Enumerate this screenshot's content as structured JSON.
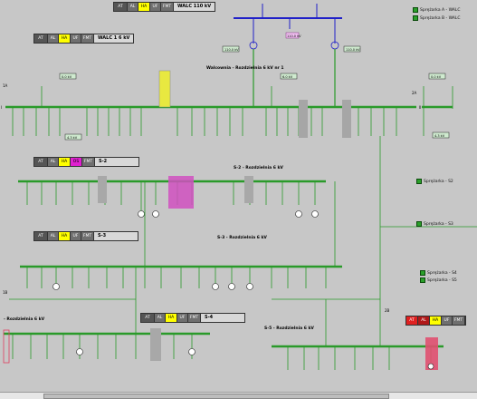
{
  "status_bars": [
    {
      "id": "walc110",
      "buttons": [
        "AT",
        "AL",
        "HA",
        "UF",
        "FMT"
      ],
      "label": "WALC 110 kV"
    },
    {
      "id": "walc16",
      "buttons": [
        "AT",
        "AL",
        "HA",
        "UF",
        "FMT"
      ],
      "label": "WALC 1 6 kV"
    },
    {
      "id": "s2",
      "buttons": [
        "AT",
        "AL",
        "HA",
        "OS",
        "FMT"
      ],
      "label": "S-2"
    },
    {
      "id": "s3",
      "buttons": [
        "AT",
        "AL",
        "HA",
        "UF",
        "FMT"
      ],
      "label": "S-3"
    },
    {
      "id": "s4",
      "buttons": [
        "AT",
        "AL",
        "HA",
        "UF",
        "FMT"
      ],
      "label": "S-4"
    },
    {
      "id": "s5",
      "buttons": [
        "AT",
        "AL",
        "HA",
        "UF",
        "FMT"
      ]
    }
  ],
  "legend": {
    "top": [
      "Sprężarka A - WALC",
      "Sprężarka B - WALC"
    ],
    "s2": "Sprężarka - S2",
    "s3": "Sprężarka - S3",
    "s4": [
      "Sprężarka - S4",
      "Sprężarka - S5"
    ]
  },
  "titles": {
    "walcownia": "Walcownia - Rozdzielnia 6 kV nr 1",
    "s2": "S-2 - Rozdzielnia 6 kV",
    "s3": "S-3 - Rozdzielnia 6 kV",
    "s4": "- Rozdzielnia 6 kV",
    "s5": "S-5 - Rozdzielnia 6 kV"
  },
  "readings": [
    "0.0 kV",
    "4.3 kV",
    "6.0 kV",
    "4.3 kV",
    "0.0 kV",
    "4.3 kV",
    "110.0 kV",
    "110.0 kV",
    "110.0 kV"
  ],
  "colors": {
    "busbar": "#2a9a2a",
    "hv": "#2020c8",
    "background": "#c7c7c7",
    "alarm_yellow": "#f0f040",
    "alarm_magenta": "#d040c0",
    "alarm_red": "#e05070"
  },
  "labels": {
    "bus_left": "I",
    "bus_right": "II",
    "marker_1a": "1A",
    "marker_2a": "2A",
    "marker_1b": "1B",
    "marker_2b": "2B"
  }
}
